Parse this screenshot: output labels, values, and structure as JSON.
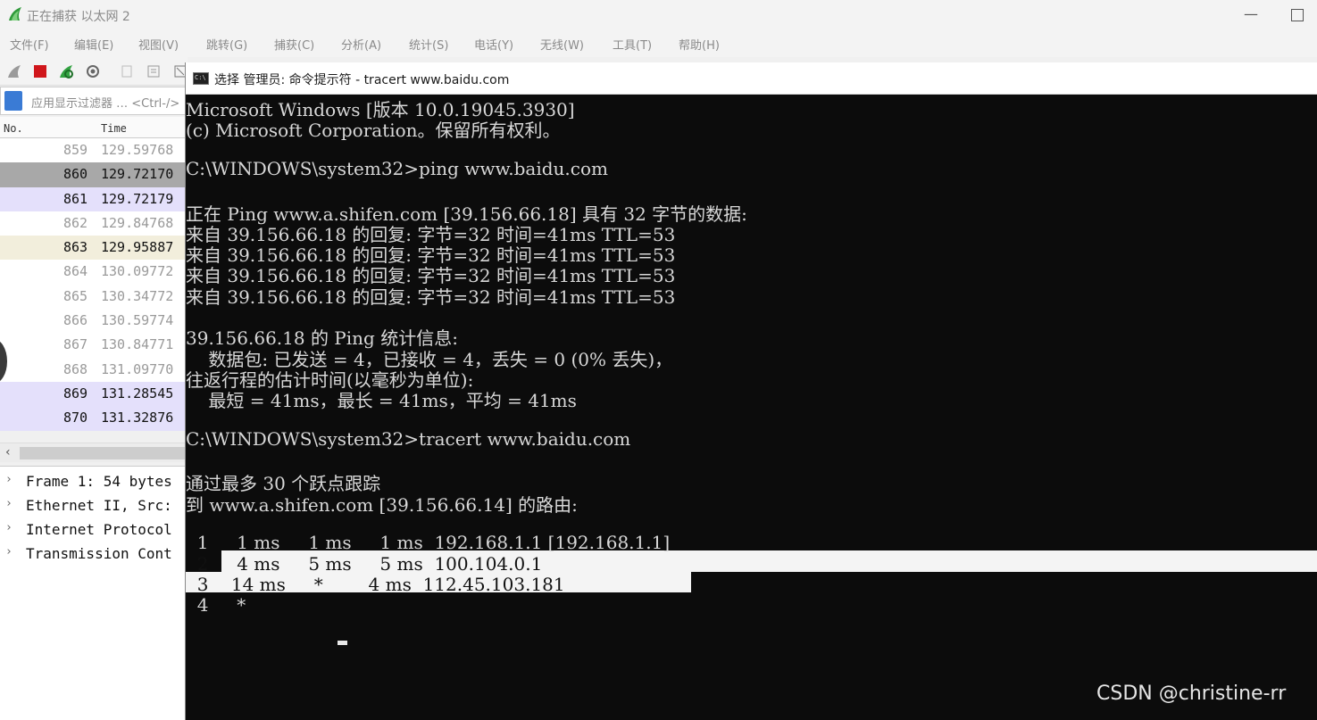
{
  "wireshark": {
    "title": "正在捕获 以太网 2",
    "menu": [
      "文件(F)",
      "编辑(E)",
      "视图(V)",
      "跳转(G)",
      "捕获(C)",
      "分析(A)",
      "统计(S)",
      "电话(Y)",
      "无线(W)",
      "工具(T)",
      "帮助(H)"
    ],
    "filter_placeholder": "应用显示过滤器 … <Ctrl-/>",
    "columns": {
      "no": "No.",
      "time": "Time"
    },
    "rows": [
      {
        "no": "859",
        "time": "129.59768",
        "color": "#ffffff",
        "fg": "#9a9a9a"
      },
      {
        "no": "860",
        "time": "129.72170",
        "color": "#a8a8a8",
        "fg": "#111111"
      },
      {
        "no": "861",
        "time": "129.72179",
        "color": "#e4e0fb",
        "fg": "#111111"
      },
      {
        "no": "862",
        "time": "129.84768",
        "color": "#ffffff",
        "fg": "#9a9a9a"
      },
      {
        "no": "863",
        "time": "129.95887",
        "color": "#f2eedc",
        "fg": "#111111"
      },
      {
        "no": "864",
        "time": "130.09772",
        "color": "#ffffff",
        "fg": "#9a9a9a"
      },
      {
        "no": "865",
        "time": "130.34772",
        "color": "#ffffff",
        "fg": "#9a9a9a"
      },
      {
        "no": "866",
        "time": "130.59774",
        "color": "#ffffff",
        "fg": "#9a9a9a"
      },
      {
        "no": "867",
        "time": "130.84771",
        "color": "#ffffff",
        "fg": "#9a9a9a"
      },
      {
        "no": "868",
        "time": "131.09770",
        "color": "#ffffff",
        "fg": "#9a9a9a"
      },
      {
        "no": "869",
        "time": "131.28545",
        "color": "#e4e0fb",
        "fg": "#111111"
      },
      {
        "no": "870",
        "time": "131.32876",
        "color": "#e4e0fb",
        "fg": "#111111"
      }
    ],
    "details": [
      "Frame 1: 54 bytes",
      "Ethernet II, Src:",
      "Internet Protocol",
      "Transmission Cont"
    ]
  },
  "cmd": {
    "title": "选择 管理员: 命令提示符 - tracert  www.baidu.com",
    "lines": [
      "Microsoft Windows [版本 10.0.19045.3930]",
      "(c) Microsoft Corporation。保留所有权利。",
      "",
      "C:\\WINDOWS\\system32>ping www.baidu.com",
      "",
      "正在 Ping www.a.shifen.com [39.156.66.18] 具有 32 字节的数据:",
      "来自 39.156.66.18 的回复: 字节=32 时间=41ms TTL=53",
      "来自 39.156.66.18 的回复: 字节=32 时间=41ms TTL=53",
      "来自 39.156.66.18 的回复: 字节=32 时间=41ms TTL=53",
      "来自 39.156.66.18 的回复: 字节=32 时间=41ms TTL=53",
      "",
      "39.156.66.18 的 Ping 统计信息:",
      "    数据包: 已发送 = 4，已接收 = 4，丢失 = 0 (0% 丢失)，",
      "往返行程的估计时间(以毫秒为单位):",
      "    最短 = 41ms，最长 = 41ms，平均 = 41ms",
      "",
      "C:\\WINDOWS\\system32>tracert www.baidu.com",
      "",
      "通过最多 30 个跃点跟踪",
      "到 www.a.shifen.com [39.156.66.14] 的路由:",
      "",
      "  1     1 ms     1 ms     1 ms  192.168.1.1 [192.168.1.1]",
      "  2     4 ms     5 ms     5 ms  100.104.0.1",
      "  3    14 ms     *        4 ms  112.45.103.181",
      "  4     *"
    ]
  },
  "watermark": "CSDN @christine-rr"
}
